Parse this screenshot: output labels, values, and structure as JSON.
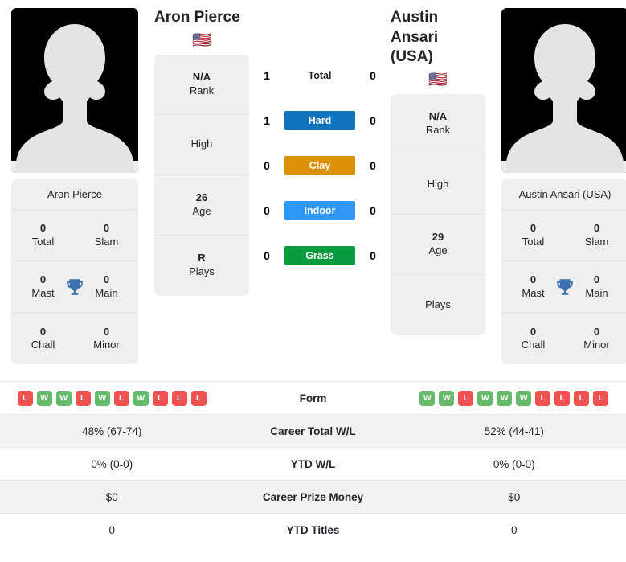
{
  "players": {
    "left": {
      "name": "Aron Pierce",
      "name_line2": "",
      "card_name": "Aron Pierce",
      "flag": "🇺🇸",
      "flag_name": "usa-flag-icon",
      "titles": [
        {
          "value": "0",
          "label": "Total"
        },
        {
          "value": "0",
          "label": "Slam"
        },
        {
          "value": "0",
          "label": "Mast"
        },
        {
          "value": "0",
          "label": "Main"
        },
        {
          "value": "0",
          "label": "Chall"
        },
        {
          "value": "0",
          "label": "Minor"
        }
      ],
      "info": [
        {
          "value": "N/A",
          "label": "Rank"
        },
        {
          "value": "",
          "label": "High"
        },
        {
          "value": "26",
          "label": "Age"
        },
        {
          "value": "R",
          "label": "Plays"
        }
      ],
      "form": [
        "L",
        "W",
        "W",
        "L",
        "W",
        "L",
        "W",
        "L",
        "L",
        "L"
      ],
      "scores": [
        "1",
        "1",
        "0",
        "0",
        "0"
      ],
      "career_total_wl": "48% (67-74)",
      "ytd_wl": "0% (0-0)",
      "career_prize_money": "$0",
      "ytd_titles": "0"
    },
    "right": {
      "name": "Austin Ansari",
      "name_line2": "(USA)",
      "card_name": "Austin Ansari (USA)",
      "flag": "🇺🇸",
      "flag_name": "usa-flag-icon",
      "titles": [
        {
          "value": "0",
          "label": "Total"
        },
        {
          "value": "0",
          "label": "Slam"
        },
        {
          "value": "0",
          "label": "Mast"
        },
        {
          "value": "0",
          "label": "Main"
        },
        {
          "value": "0",
          "label": "Chall"
        },
        {
          "value": "0",
          "label": "Minor"
        }
      ],
      "info": [
        {
          "value": "N/A",
          "label": "Rank"
        },
        {
          "value": "",
          "label": "High"
        },
        {
          "value": "29",
          "label": "Age"
        },
        {
          "value": "",
          "label": "Plays"
        }
      ],
      "form": [
        "W",
        "W",
        "L",
        "W",
        "W",
        "W",
        "L",
        "L",
        "L",
        "L"
      ],
      "scores": [
        "0",
        "0",
        "0",
        "0",
        "0"
      ],
      "career_total_wl": "52% (44-41)",
      "ytd_wl": "0% (0-0)",
      "career_prize_money": "$0",
      "ytd_titles": "0"
    }
  },
  "surfaces": [
    {
      "label": "Total",
      "color": "transparent",
      "plain": true
    },
    {
      "label": "Hard",
      "color": "#1074bc",
      "plain": false
    },
    {
      "label": "Clay",
      "color": "#dd9109",
      "plain": false
    },
    {
      "label": "Indoor",
      "color": "#2f97f5",
      "plain": false
    },
    {
      "label": "Grass",
      "color": "#099c3f",
      "plain": false
    }
  ],
  "table_rows": [
    {
      "label": "Form"
    },
    {
      "label": "Career Total W/L"
    },
    {
      "label": "YTD W/L"
    },
    {
      "label": "Career Prize Money"
    },
    {
      "label": "YTD Titles"
    }
  ],
  "colors": {
    "win": "#66bb6a",
    "loss": "#ef5350",
    "card_bg": "#efefef",
    "stripe": "#f2f2f2",
    "trophy": "#3a6fb0"
  }
}
